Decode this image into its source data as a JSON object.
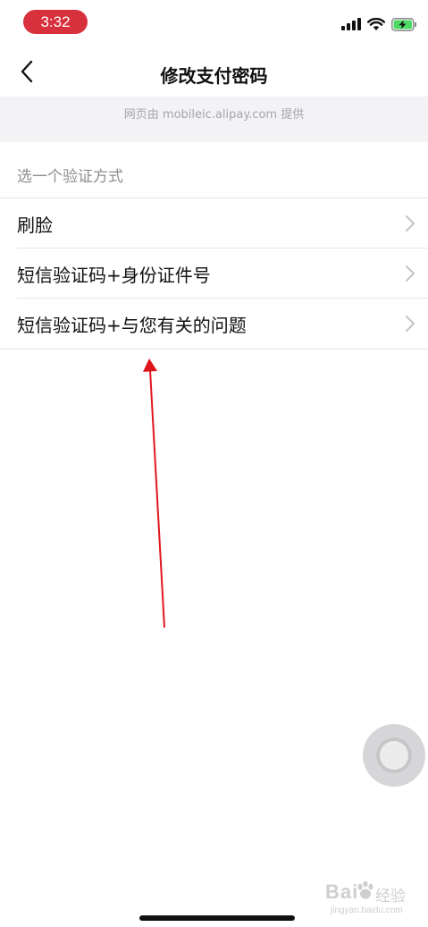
{
  "status_bar": {
    "time": "3:32",
    "icons": [
      "cellular-signal-icon",
      "wifi-icon",
      "battery-charging-icon"
    ],
    "time_pill_color": "#d8303c"
  },
  "nav": {
    "title": "修改支付密码",
    "back_icon": "chevron-left-icon"
  },
  "banner": {
    "text": "网页由 mobileic.alipay.com 提供"
  },
  "section": {
    "header": "选一个验证方式"
  },
  "options": [
    {
      "label": "刷脸",
      "icon": "chevron-right-icon"
    },
    {
      "label": "短信验证码+身份证件号",
      "icon": "chevron-right-icon"
    },
    {
      "label": "短信验证码+与您有关的问题",
      "icon": "chevron-right-icon"
    }
  ],
  "annotation": {
    "arrow_color": "#e0161f",
    "icon": "red-arrow-icon"
  },
  "watermark": {
    "brand": "Bai",
    "text": "经验",
    "url": "jingyan.baidu.com"
  },
  "colors": {
    "text_primary": "#111111",
    "text_secondary": "#8e8e93",
    "banner_bg": "#f3f3f5",
    "divider": "#e6e6ea"
  }
}
